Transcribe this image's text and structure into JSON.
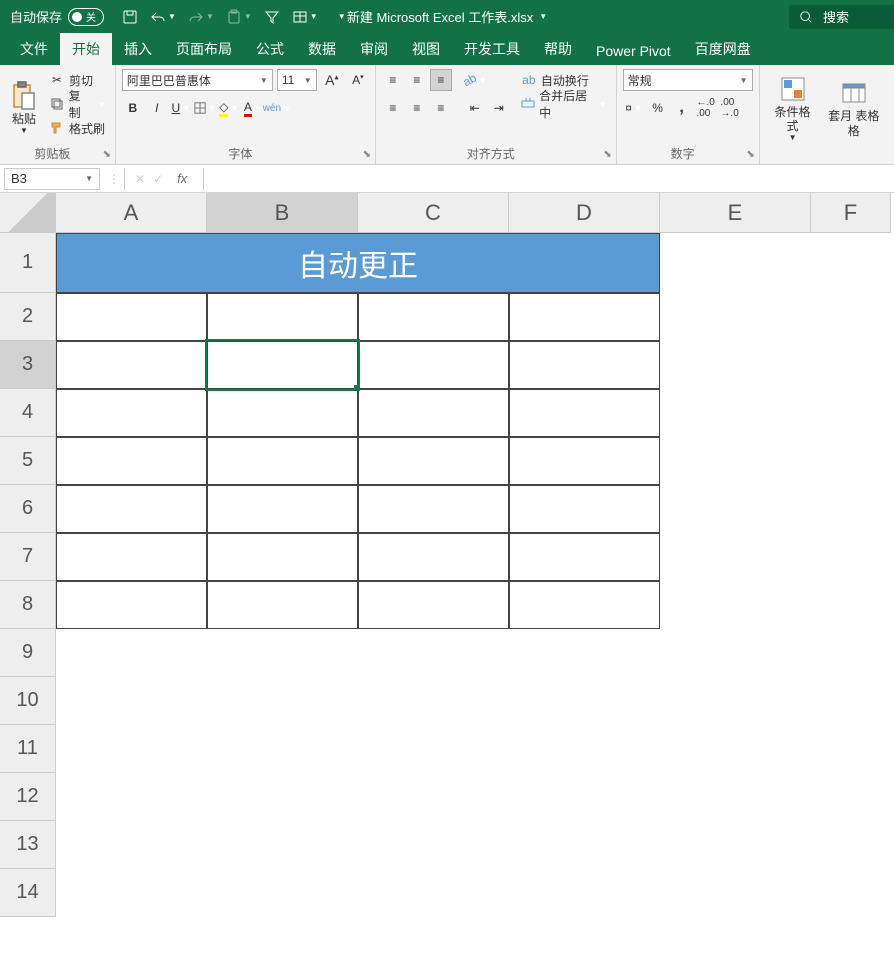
{
  "titlebar": {
    "autosave_label": "自动保存",
    "autosave_state": "关",
    "filename": "新建 Microsoft Excel 工作表.xlsx",
    "search_placeholder": "搜索"
  },
  "tabs": {
    "file": "文件",
    "home": "开始",
    "insert": "插入",
    "layout": "页面布局",
    "formula": "公式",
    "data": "数据",
    "review": "审阅",
    "view": "视图",
    "dev": "开发工具",
    "help": "帮助",
    "pivot": "Power Pivot",
    "baidu": "百度网盘"
  },
  "ribbon": {
    "clipboard": {
      "paste": "粘贴",
      "cut": "剪切",
      "copy": "复制",
      "fmt": "格式刷",
      "group": "剪贴板"
    },
    "font": {
      "name": "阿里巴巴普惠体",
      "size": "11",
      "pinyin": "wén",
      "group": "字体"
    },
    "align": {
      "wrap": "自动换行",
      "merge": "合并后居中",
      "group": "对齐方式"
    },
    "number": {
      "format": "常规",
      "group": "数字"
    },
    "styles": {
      "cond": "条件格式",
      "tblfmt": "套月\n表格格"
    }
  },
  "namebox": "B3",
  "columns": [
    "A",
    "B",
    "C",
    "D",
    "E",
    "F"
  ],
  "rows": [
    "1",
    "2",
    "3",
    "4",
    "5",
    "6",
    "7",
    "8",
    "9",
    "10",
    "11",
    "12",
    "13",
    "14"
  ],
  "cells": {
    "merged_title": "自动更正"
  }
}
